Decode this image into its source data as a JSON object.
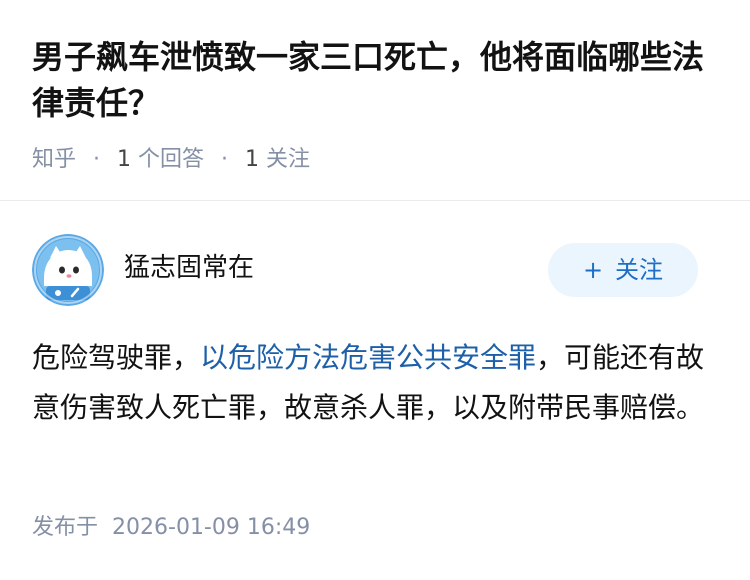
{
  "question": {
    "title": "男子飙车泄愤致一家三口死亡，他将面临哪些法律责任？",
    "source": "知乎",
    "answers_count": "1",
    "answers_label": "个回答",
    "followers_count": "1",
    "followers_label": "关注"
  },
  "answer": {
    "author_name": "猛志固常在",
    "avatar_icon": "cartoon-astronaut-cat-avatar",
    "follow_button": {
      "icon": "+",
      "label": "关注"
    },
    "content": {
      "before_link": "危险驾驶罪，",
      "link_text": "以危险方法危害公共安全罪",
      "after_link": "，可能还有故意伤害致人死亡罪，故意杀人罪，以及附带民事赔偿。"
    },
    "publish_label": "发布于",
    "publish_time": "2026-01-09 16:49"
  },
  "colors": {
    "text_primary": "#121212",
    "text_secondary": "#8590a6",
    "link": "#1d5fa8",
    "follow_button_bg": "#ebf5fd",
    "follow_button_text": "#1d6ec4",
    "avatar_bg": "#5aa9e6"
  }
}
